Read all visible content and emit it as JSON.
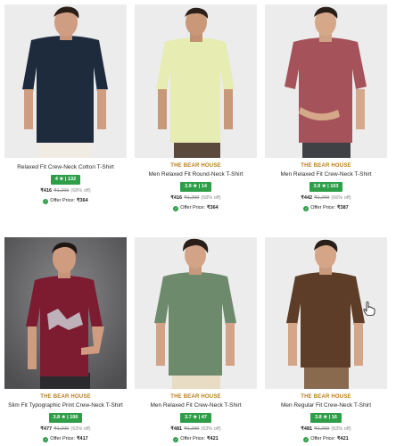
{
  "products": [
    {
      "brand": "",
      "name": "Relaxed Fit Crew-Neck Cotton T-Shirt",
      "rating": "4 ★ | 132",
      "sale_price": "₹416",
      "mrp": "₹1,299",
      "discount": "(68% off)",
      "offer_label": "Offer Price:",
      "offer_price": "₹364",
      "tshirt_color": "#1e2b3d",
      "pants_color": "#f1ece3"
    },
    {
      "brand": "THE BEAR HOUSE",
      "name": "Men Relaxed Fit Round-Neck T-Shirt",
      "rating": "3.9 ★ | 14",
      "sale_price": "₹416",
      "mrp": "₹1,299",
      "discount": "(68% off)",
      "offer_label": "Offer Price:",
      "offer_price": "₹364",
      "tshirt_color": "#e6ecb2",
      "pants_color": "#5b4a3c"
    },
    {
      "brand": "THE BEAR HOUSE",
      "name": "Men Relaxed Fit Crew-Neck T-Shirt",
      "rating": "3.9 ★ | 103",
      "sale_price": "₹442",
      "mrp": "₹1,299",
      "discount": "(66% off)",
      "offer_label": "Offer Price:",
      "offer_price": "₹387",
      "tshirt_color": "#a5525a",
      "pants_color": "#3f4144"
    },
    {
      "brand": "THE BEAR HOUSE",
      "name": "Slim Fit Typographic Print Crew-Neck T-Shirt",
      "rating": "3.8 ★ | 106",
      "sale_price": "₹477",
      "mrp": "₹1,299",
      "discount": "(63% off)",
      "offer_label": "Offer Price:",
      "offer_price": "₹417",
      "tshirt_color": "#7d1c30",
      "pants_color": "#2b2b2d"
    },
    {
      "brand": "THE BEAR HOUSE",
      "name": "Men Relaxed Fit Crew-Neck T-Shirt",
      "rating": "3.7 ★ | 47",
      "sale_price": "₹481",
      "mrp": "₹1,299",
      "discount": "(63% off)",
      "offer_label": "Offer Price:",
      "offer_price": "₹421",
      "tshirt_color": "#6e8a6d",
      "pants_color": "#e8dcc4"
    },
    {
      "brand": "THE BEAR HOUSE",
      "name": "Men Regular Fit Crew-Neck T-Shirt",
      "rating": "3.8 ★ | 16",
      "sale_price": "₹481",
      "mrp": "₹1,299",
      "discount": "(63% off)",
      "offer_label": "Offer Price:",
      "offer_price": "₹421",
      "tshirt_color": "#5d3d27",
      "pants_color": "#8a6a4f"
    }
  ],
  "colors": {
    "brand_text": "#b87e18",
    "rating_badge": "#2f9e48",
    "photo_bg": "#e9e9ea"
  },
  "icons": {
    "offer": "tag-check-icon",
    "cursor": "hand-pointer-icon"
  }
}
